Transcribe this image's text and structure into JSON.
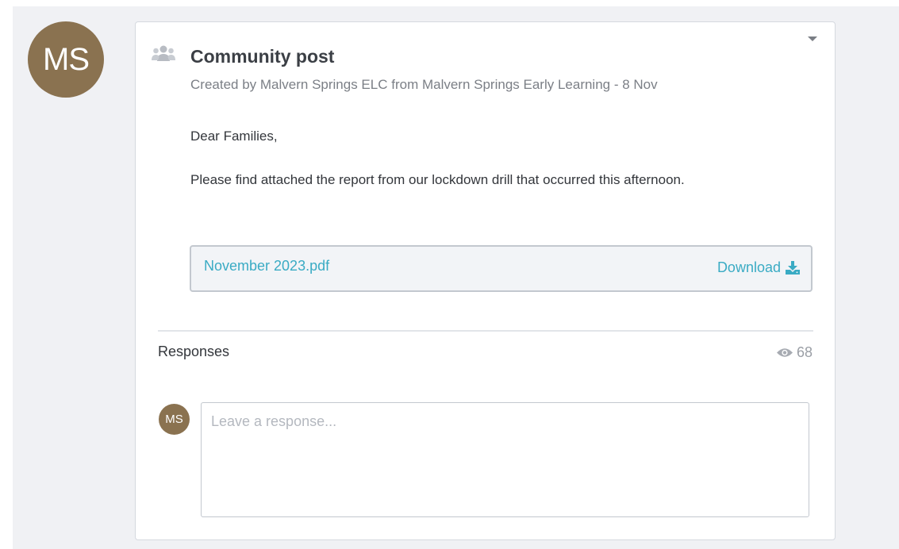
{
  "post": {
    "author_initials": "MS",
    "title": "Community post",
    "meta": "Created by Malvern Springs ELC from Malvern Springs Early Learning - 8 Nov",
    "greeting": "Dear Families,",
    "body": "Please find attached the report from our lockdown drill that occurred this afternoon.",
    "icon": "group-icon",
    "menu_icon": "caret-down-icon"
  },
  "attachment": {
    "file_name": "November 2023.pdf",
    "download_label": "Download",
    "download_icon": "download-icon"
  },
  "responses": {
    "label": "Responses",
    "view_count": "68",
    "view_icon": "eye-icon",
    "user_initials": "MS",
    "input_placeholder": "Leave a response...",
    "input_value": ""
  },
  "colors": {
    "avatar": "#8a7250",
    "link": "#3aabc4",
    "background": "#f0f1f4"
  }
}
